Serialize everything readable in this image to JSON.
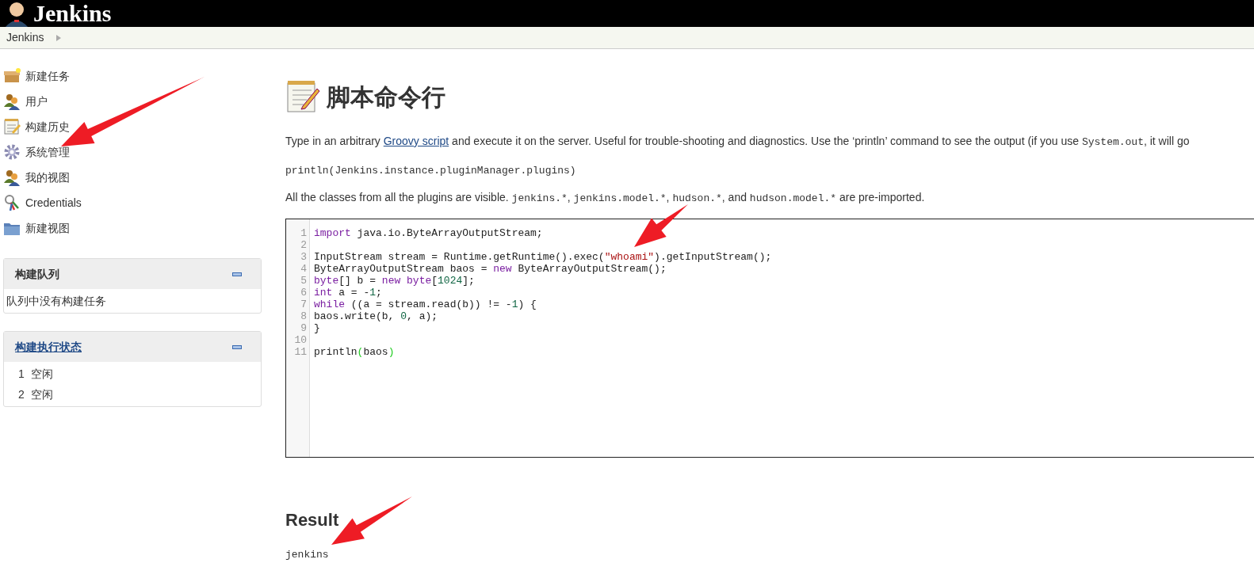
{
  "header": {
    "title": "Jenkins"
  },
  "breadcrumb": [
    {
      "label": "Jenkins"
    }
  ],
  "sidebar": {
    "tasks": [
      {
        "label": "新建任务",
        "kind": "box"
      },
      {
        "label": "用户",
        "kind": "people"
      },
      {
        "label": "构建历史",
        "kind": "notepad"
      },
      {
        "label": "系统管理",
        "kind": "gear"
      },
      {
        "label": "我的视图",
        "kind": "people"
      },
      {
        "label": "Credentials",
        "kind": "keys"
      },
      {
        "label": "新建视图",
        "kind": "folder"
      }
    ],
    "panels": [
      {
        "title": "构建队列",
        "title_link": false,
        "rows": [
          {
            "number": "",
            "text": "队列中没有构建任务"
          }
        ]
      },
      {
        "title": "构建执行状态",
        "title_link": true,
        "rows": [
          {
            "number": "1",
            "text": "空闲"
          },
          {
            "number": "2",
            "text": "空闲"
          }
        ]
      }
    ]
  },
  "main": {
    "title": "脚本命令行",
    "description": [
      {
        "text": "Type in an arbitrary ",
        "kind": "text"
      },
      {
        "text": "Groovy script",
        "kind": "link"
      },
      {
        "text": " and execute it on the server. Useful for trouble-shooting and diagnostics. Use the ‘println’ command to see the output (if you use ",
        "kind": "text"
      },
      {
        "text": "System.out",
        "kind": "code"
      },
      {
        "text": ", it will go",
        "kind": "text"
      }
    ],
    "example": "println(Jenkins.instance.pluginManager.plugins)",
    "imports_note": [
      {
        "text": "All the classes from all the plugins are visible. ",
        "kind": "text"
      },
      {
        "text": "jenkins.*",
        "kind": "code"
      },
      {
        "text": ", ",
        "kind": "text"
      },
      {
        "text": "jenkins.model.*",
        "kind": "code"
      },
      {
        "text": ", ",
        "kind": "text"
      },
      {
        "text": "hudson.*",
        "kind": "code"
      },
      {
        "text": ", and ",
        "kind": "text"
      },
      {
        "text": "hudson.model.*",
        "kind": "code"
      },
      {
        "text": " are pre-imported.",
        "kind": "text"
      }
    ],
    "editor": {
      "lines": [
        {
          "number": "1",
          "tokens": [
            {
              "text": "import",
              "kind": "keyword"
            },
            {
              "text": " java.io.ByteArrayOutputStream;",
              "kind": "plain"
            }
          ]
        },
        {
          "number": "2"
        },
        {
          "number": "3",
          "tokens": [
            {
              "text": "InputStream stream = Runtime.getRuntime().exec(",
              "kind": "plain"
            },
            {
              "text": "\"whoami\"",
              "kind": "string"
            },
            {
              "text": ").getInputStream();",
              "kind": "plain"
            }
          ]
        },
        {
          "number": "4",
          "tokens": [
            {
              "text": "ByteArrayOutputStream baos = ",
              "kind": "plain"
            },
            {
              "text": "new",
              "kind": "keyword"
            },
            {
              "text": " ByteArrayOutputStream();",
              "kind": "plain"
            }
          ]
        },
        {
          "number": "5",
          "tokens": [
            {
              "text": "byte",
              "kind": "keyword"
            },
            {
              "text": "[] b = ",
              "kind": "plain"
            },
            {
              "text": "new byte",
              "kind": "keyword"
            },
            {
              "text": "[",
              "kind": "plain"
            },
            {
              "text": "1024",
              "kind": "number"
            },
            {
              "text": "];",
              "kind": "plain"
            }
          ]
        },
        {
          "number": "6",
          "tokens": [
            {
              "text": "int",
              "kind": "keyword"
            },
            {
              "text": " a = -",
              "kind": "plain"
            },
            {
              "text": "1",
              "kind": "number"
            },
            {
              "text": ";",
              "kind": "plain"
            }
          ]
        },
        {
          "number": "7",
          "tokens": [
            {
              "text": "while",
              "kind": "keyword"
            },
            {
              "text": " ((a = stream.read(b)) != -",
              "kind": "plain"
            },
            {
              "text": "1",
              "kind": "number"
            },
            {
              "text": ") {",
              "kind": "plain"
            }
          ]
        },
        {
          "number": "8",
          "tokens": [
            {
              "text": "baos.write(b, ",
              "kind": "plain"
            },
            {
              "text": "0",
              "kind": "number"
            },
            {
              "text": ", a);",
              "kind": "plain"
            }
          ]
        },
        {
          "number": "9",
          "tokens": [
            {
              "text": "}",
              "kind": "plain"
            }
          ]
        },
        {
          "number": "10"
        },
        {
          "number": "11",
          "tokens": [
            {
              "text": "println",
              "kind": "plain"
            },
            {
              "text": "(",
              "kind": "bracket"
            },
            {
              "text": "baos",
              "kind": "plain"
            },
            {
              "text": ")",
              "kind": "bracket"
            }
          ]
        }
      ]
    },
    "result": {
      "title": "Result",
      "output": "jenkins"
    }
  }
}
